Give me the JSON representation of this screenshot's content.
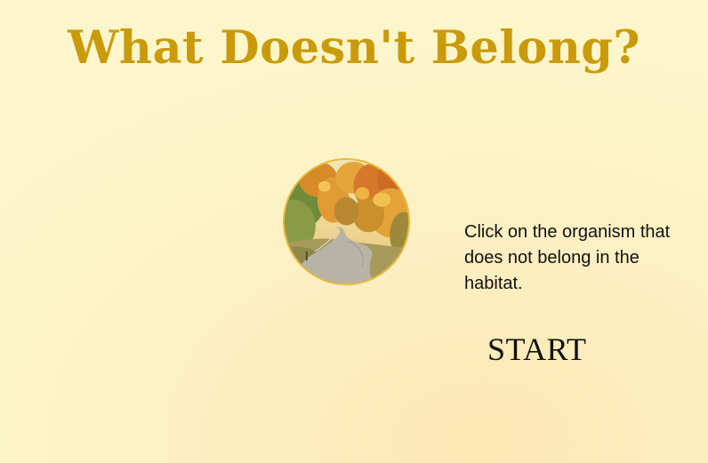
{
  "title": "What Doesn't Belong?",
  "habitat": {
    "icon": "autumn-forest-road-image"
  },
  "instructions": "Click on the organism that does not belong in the habitat.",
  "start_label": "START",
  "colors": {
    "title": "#c99a0a",
    "background": "#fdf6cb",
    "image_border": "#e8b93a",
    "text": "#111111"
  }
}
